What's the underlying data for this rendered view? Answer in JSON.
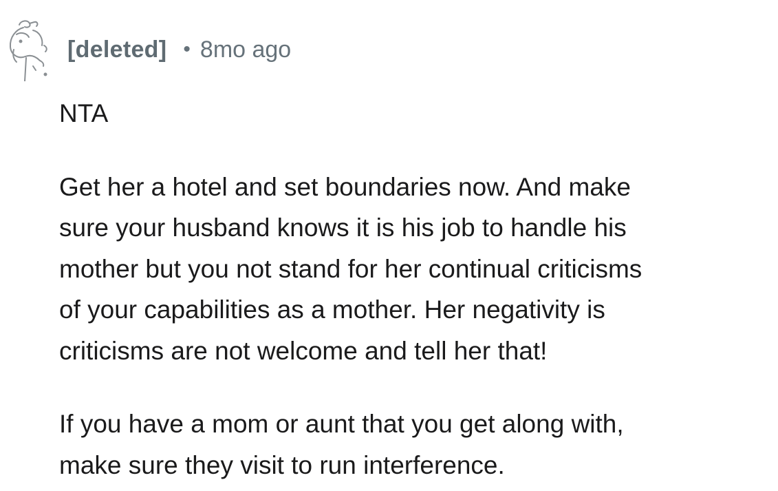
{
  "comment": {
    "author": "[deleted]",
    "separator": "•",
    "timestamp": "8mo ago",
    "avatar_icon": "deleted-user-snoo-icon",
    "paragraphs": [
      [
        "NTA"
      ],
      [
        "Get her a hotel and set boundaries now. And make",
        "sure your husband knows it is his job to handle his",
        "mother but you not stand for her continual criticisms",
        "of your capabilities as a mother. Her negativity is",
        "criticisms are not welcome and tell her that!"
      ],
      [
        "If you have a mom or aunt that you get along with,",
        "make sure they visit to run interference."
      ]
    ]
  }
}
